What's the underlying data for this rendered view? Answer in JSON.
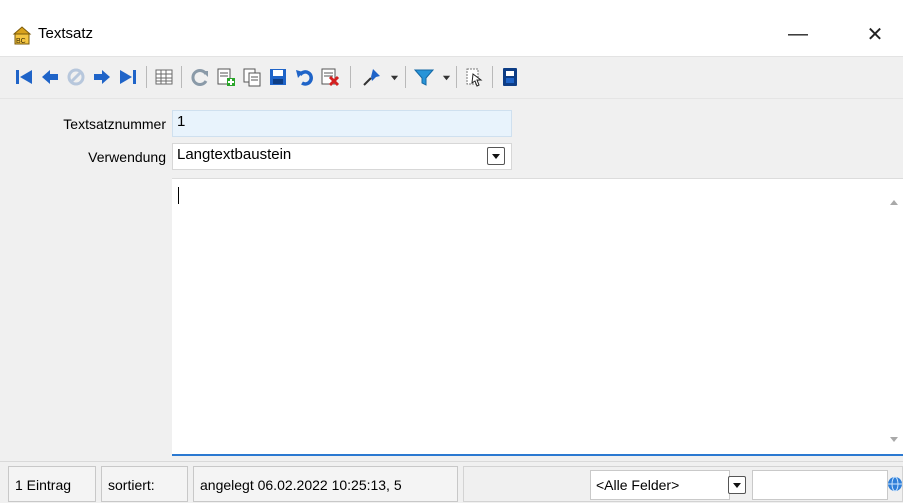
{
  "window": {
    "title": "Textsatz",
    "minimize_label": "—",
    "close_label": "✕"
  },
  "toolbar": {
    "buttons": [
      "first-record-icon",
      "previous-record-icon",
      "disabled-record-icon",
      "next-record-icon",
      "last-record-icon",
      "table-view-icon",
      "refresh-icon",
      "new-record-icon",
      "copy-record-icon",
      "save-icon",
      "undo-icon",
      "delete-icon",
      "pin-icon",
      "filter-icon",
      "select-icon",
      "panel-icon"
    ]
  },
  "form": {
    "number_label": "Textsatznummer",
    "number_value": "1",
    "usage_label": "Verwendung",
    "usage_value": "Langtextbaustein"
  },
  "status": {
    "entries": "1 Eintrag",
    "sorted": "sortiert:",
    "created": "angelegt 06.02.2022 10:25:13,  5",
    "fields_filter": "<Alle Felder>"
  },
  "colors": {
    "accent_blue": "#1f64c8",
    "focus_line": "#2b79d1",
    "field_bg": "#e8f3fc"
  }
}
